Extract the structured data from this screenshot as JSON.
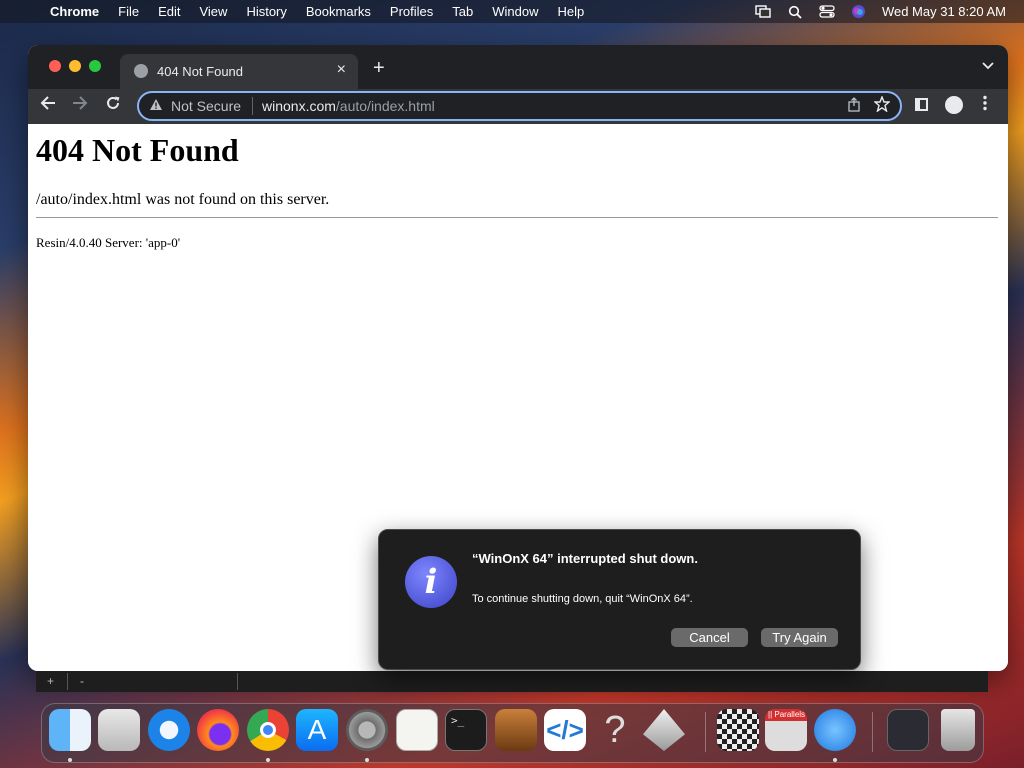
{
  "menubar": {
    "apple": "",
    "items": [
      "Chrome",
      "File",
      "Edit",
      "View",
      "History",
      "Bookmarks",
      "Profiles",
      "Tab",
      "Window",
      "Help"
    ],
    "datetime": "Wed May 31  8:20 AM"
  },
  "browser": {
    "tab_title": "404 Not Found",
    "tab_close": "×",
    "new_tab": "+",
    "omnibox": {
      "security": "Not Secure",
      "host": "winonx.com",
      "path": "/auto/index.html"
    }
  },
  "page": {
    "heading": "404 Not Found",
    "message": "/auto/index.html was not found on this server.",
    "footer": "Resin/4.0.40 Server: 'app-0'"
  },
  "terminal_strip": {
    "plus": "+",
    "minus": "-"
  },
  "dialog": {
    "title": "“WinOnX 64” interrupted shut down.",
    "body": "To continue shutting down, quit “WinOnX 64”.",
    "cancel": "Cancel",
    "try_again": "Try Again"
  },
  "dock": {
    "terminal_glyph": ">_",
    "parallels_label": "|| Parallels",
    "items": [
      "finder-icon",
      "launchpad-icon",
      "safari-icon",
      "firefox-icon",
      "chrome-icon",
      "app-store-icon",
      "system-settings-icon",
      "textedit-icon",
      "terminal-icon",
      "garageband-icon",
      "vscode-icon",
      "help-icon",
      "winonx-icon",
      "chess-icon",
      "parallels-icon",
      "app-grid-icon",
      "downloads-icon",
      "trash-icon"
    ]
  }
}
